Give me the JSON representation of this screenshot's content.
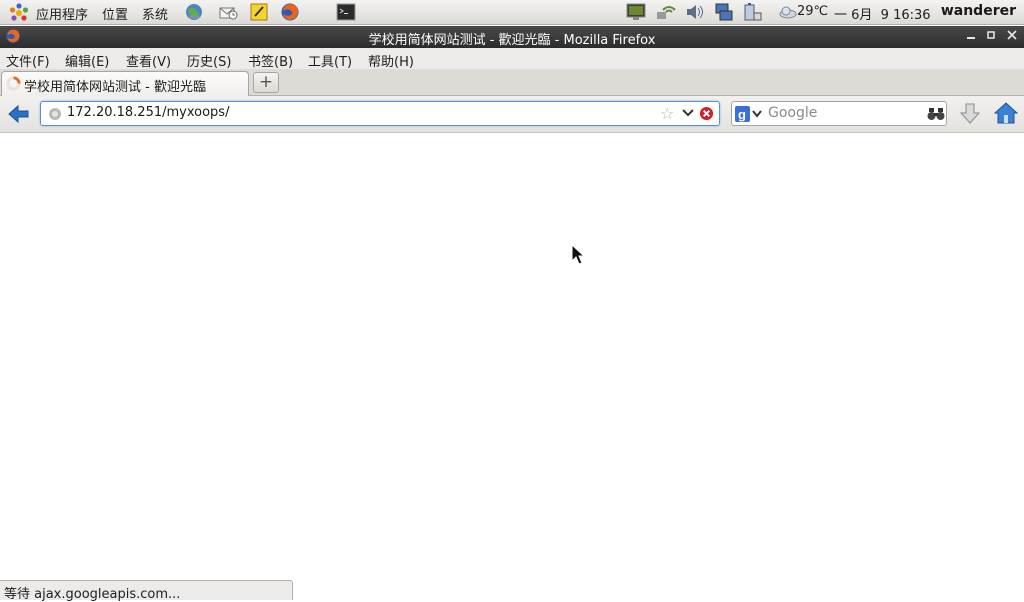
{
  "panel": {
    "menus": [
      "应用程序",
      "位置",
      "系统"
    ],
    "launchers": [
      "browser-globe-icon",
      "mail-icon",
      "notes-icon",
      "firefox-icon",
      "terminal-icon"
    ],
    "tray": [
      "monitor-icon",
      "network-icon",
      "volume-icon",
      "network-manager-icon",
      "battery-icon"
    ],
    "weather": "29℃",
    "clock": "一 6月  9 16:36",
    "user": "wanderer"
  },
  "window": {
    "title": "学校用简体网站测试 - 歡迎光臨 - Mozilla Firefox"
  },
  "menubar": [
    "文件(F)",
    "编辑(E)",
    "查看(V)",
    "历史(S)",
    "书签(B)",
    "工具(T)",
    "帮助(H)"
  ],
  "tabs": [
    {
      "label": "学校用简体网站测试 - 歡迎光臨",
      "loading": true
    }
  ],
  "navbar": {
    "url": "172.20.18.251/myxoops/",
    "search_placeholder": "Google",
    "search_engine": "google-icon"
  },
  "status": {
    "text": "等待 ajax.googleapis.com..."
  },
  "colors": {
    "titlebar": "#2f2f2f",
    "url_focus": "#5b8fd6",
    "nav_icon_blue": "#2a72c8",
    "stop_red": "#d0202a"
  }
}
